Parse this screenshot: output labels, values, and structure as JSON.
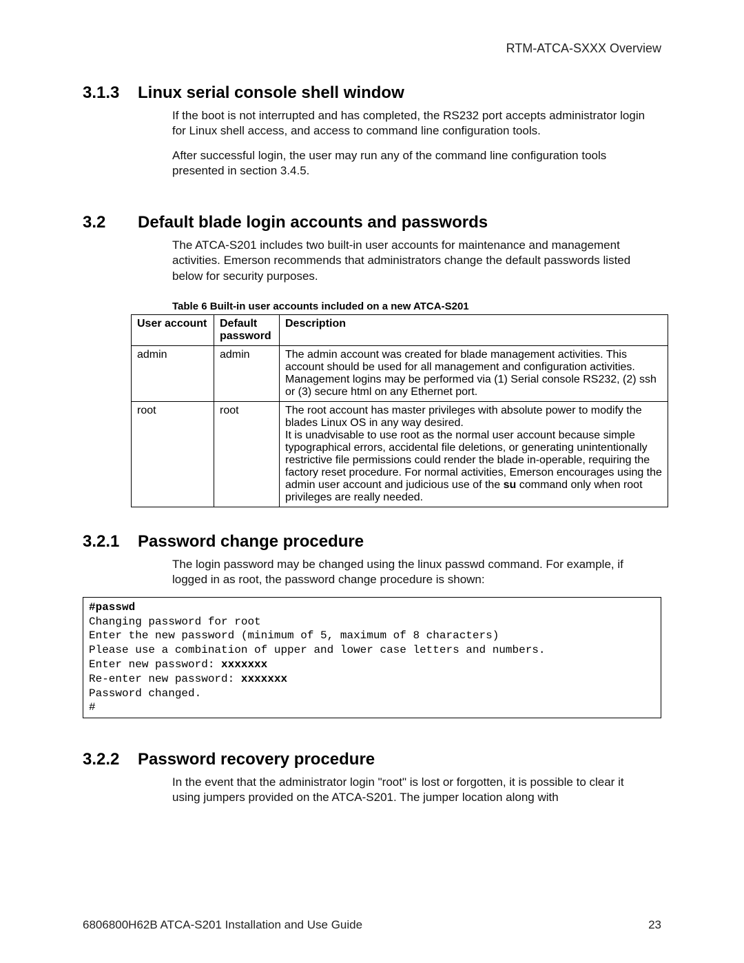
{
  "header": {
    "title": "RTM-ATCA-SXXX Overview"
  },
  "sections": {
    "s313": {
      "num": "3.1.3",
      "title": "Linux serial console shell window",
      "p1": "If the boot is not interrupted and has completed, the RS232 port accepts administrator login for Linux shell access, and access to command line configuration tools.",
      "p2": "After successful login, the user may run any of the command line configuration tools presented in section 3.4.5."
    },
    "s32": {
      "num": "3.2",
      "title": "Default blade login accounts and passwords",
      "p1": "The ATCA-S201 includes two built-in user accounts for maintenance and management activities.  Emerson recommends that administrators change the default passwords listed below for security purposes."
    },
    "table6": {
      "caption": "Table 6 Built-in user accounts included on a new ATCA-S201",
      "headers": {
        "c1": "User account",
        "c2": "Default password",
        "c3": "Description"
      },
      "rows": [
        {
          "account": "admin",
          "password": "admin",
          "desc": "The admin account was created for blade management activities.  This account should be used for all management and configuration activities.  Management logins may be performed via (1) Serial console RS232, (2) ssh or (3) secure html on any Ethernet port."
        },
        {
          "account": "root",
          "password": "root",
          "desc_pre": "The root account has master privileges with absolute power to modify the blades Linux OS in any way desired.\nIt is unadvisable to use root as the normal user account because simple typographical errors,  accidental file deletions, or generating unintentionally restrictive file permissions could render the blade in-operable, requiring the factory reset procedure.  For normal activities, Emerson encourages using the admin user account and judicious use of the ",
          "desc_bold": "su",
          "desc_post": " command only when root privileges are really needed."
        }
      ]
    },
    "s321": {
      "num": "3.2.1",
      "title": "Password change procedure",
      "p1": "The login password may be changed using the linux passwd command.  For example, if logged in as root, the password change procedure is shown:"
    },
    "code": {
      "l1_bold": "#passwd",
      "l2": "Changing password for root",
      "l3": "Enter the new password (minimum of 5, maximum of 8 characters)",
      "l4": "Please use a combination of upper and lower case letters and numbers.",
      "l5_pre": "Enter new password: ",
      "l5_bold": "xxxxxxx",
      "l6_pre": "Re-enter new password: ",
      "l6_bold": "xxxxxxx",
      "l7": "Password changed.",
      "l8": "#"
    },
    "s322": {
      "num": "3.2.2",
      "title": "Password recovery procedure",
      "p1": "In the event that the administrator login \"root\" is lost or forgotten, it is possible to clear it using jumpers provided on the ATCA-S201.  The jumper location along with"
    }
  },
  "footer": {
    "left": "6806800H62B ATCA-S201 Installation and Use Guide",
    "right": "23"
  }
}
